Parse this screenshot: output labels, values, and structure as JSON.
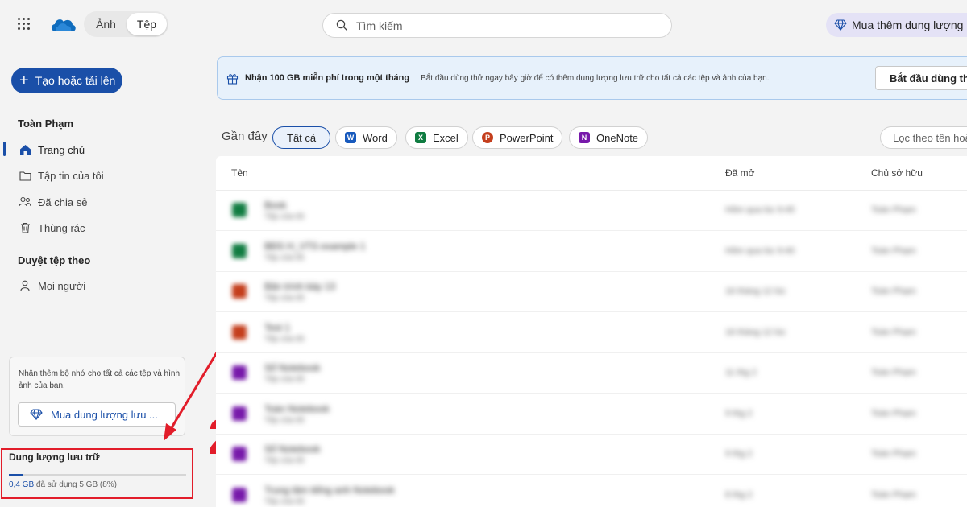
{
  "header": {
    "view_toggle": [
      "Ảnh",
      "Tệp"
    ],
    "active_view": "Tệp",
    "search_placeholder": "Tìm kiếm",
    "buy_storage_label": "Mua thêm dung lượng lưu"
  },
  "sidebar": {
    "create_label": "Tạo hoặc tải lên",
    "user_name": "Toàn Phạm",
    "items": [
      {
        "label": "Trang chủ",
        "icon": "home-icon"
      },
      {
        "label": "Tập tin của tôi",
        "icon": "folder-icon"
      },
      {
        "label": "Đã chia sẻ",
        "icon": "people-icon"
      },
      {
        "label": "Thùng rác",
        "icon": "trash-icon"
      }
    ],
    "browse_title": "Duyệt tệp theo",
    "browse_items": [
      {
        "label": "Mọi người",
        "icon": "person-icon"
      }
    ],
    "promo_text": "Nhận thêm bộ nhớ cho tất cả các tệp và hình ảnh của bạn.",
    "promo_button": "Mua dung lượng lưu ...",
    "storage": {
      "title": "Dung lượng lưu trữ",
      "used_amount": "0,4 GB",
      "used_rest": "đã sử dụng 5 GB (8%)",
      "percent": 8
    }
  },
  "banner": {
    "title": "Nhận 100 GB miễn phí trong một tháng",
    "description": "Bắt đầu dùng thử ngay bây giờ để có thêm dung lượng lưu trữ cho tất cả các tệp và ảnh của bạn.",
    "button": "Bắt đầu dùng thử"
  },
  "filters": {
    "recent_label": "Gần đây",
    "pills": [
      "Tất cả",
      "Word",
      "Excel",
      "PowerPoint",
      "OneNote"
    ],
    "filter_placeholder": "Lọc theo tên hoặc"
  },
  "table": {
    "columns": [
      "Tên",
      "Đã mở",
      "Chủ sở hữu"
    ],
    "rows": [
      {
        "type": "excel",
        "name": "Book",
        "sub": "Tệp của tôi",
        "opened": "Hôm qua lúc 9:45",
        "owner": "Toàn Phạm"
      },
      {
        "type": "excel",
        "name": "BĐS H_VTS example 1",
        "sub": "Tệp của tôi",
        "opened": "Hôm qua lúc 9:40",
        "owner": "Toàn Phạm"
      },
      {
        "type": "powerpoint",
        "name": "Bản trình bày 13",
        "sub": "Tệp của tôi",
        "opened": "16 tháng 12 lúc",
        "owner": "Toàn Phạm"
      },
      {
        "type": "powerpoint",
        "name": "Test 1",
        "sub": "Tệp của tôi",
        "opened": "16 tháng 12 lúc",
        "owner": "Toàn Phạm"
      },
      {
        "type": "onenote",
        "name": "Sổ Notebook",
        "sub": "Tệp của tôi",
        "opened": "11 thg 2",
        "owner": "Toàn Phạm"
      },
      {
        "type": "onenote",
        "name": "Toàn  Notebook",
        "sub": "Tệp của tôi",
        "opened": "9 thg 2",
        "owner": "Toàn Phạm"
      },
      {
        "type": "onenote",
        "name": "Sổ Notebook",
        "sub": "Tệp của tôi",
        "opened": "9 thg 2",
        "owner": "Toàn Phạm"
      },
      {
        "type": "onenote",
        "name": "Trung tâm tiếng anh Notebook",
        "sub": "Tệp của tôi",
        "opened": "8 thg 2",
        "owner": "Toàn Phạm"
      }
    ]
  },
  "annotation": {
    "step_number": "2"
  },
  "colors": {
    "accent": "#1a4fa8",
    "highlight_red": "#e21d2a",
    "excel": "#107c41",
    "powerpoint": "#c43e1c",
    "onenote": "#7719aa",
    "word": "#185abd"
  }
}
